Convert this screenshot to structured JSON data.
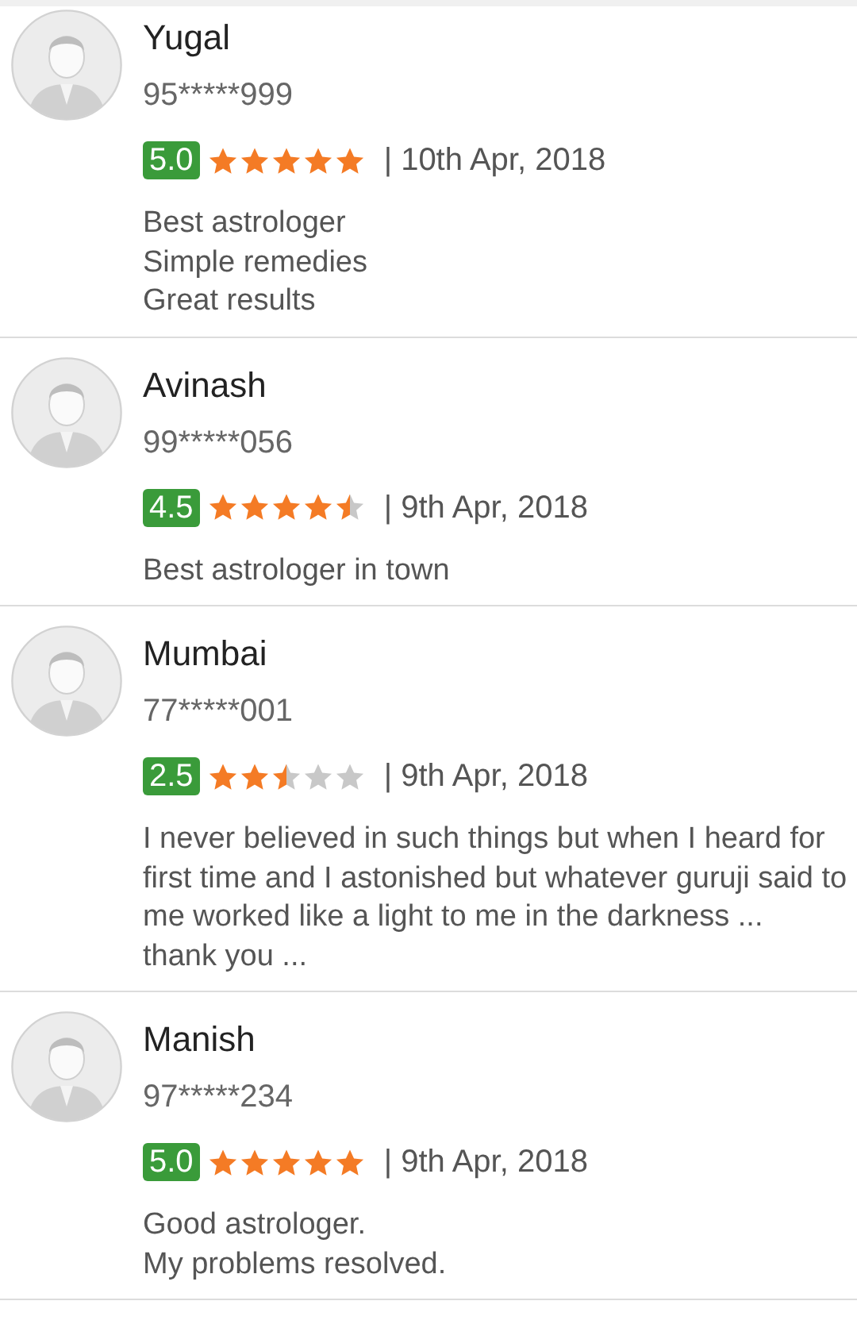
{
  "reviews": [
    {
      "name": "Yugal",
      "phone": "95*****999",
      "rating": "5.0",
      "stars": 5,
      "date": "| 10th Apr, 2018",
      "comment": "Best astrologer\nSimple remedies\nGreat results"
    },
    {
      "name": "Avinash",
      "phone": "99*****056",
      "rating": "4.5",
      "stars": 4.5,
      "date": "| 9th Apr, 2018",
      "comment": "Best astrologer in town"
    },
    {
      "name": "Mumbai",
      "phone": "77*****001",
      "rating": "2.5",
      "stars": 2.5,
      "date": "| 9th Apr, 2018",
      "comment": "I never believed in such things but when I heard for first time and I astonished but whatever guruji said to me worked like a light to me in the darkness ...\nthank you ..."
    },
    {
      "name": "Manish",
      "phone": "97*****234",
      "rating": "5.0",
      "stars": 5,
      "date": "| 9th Apr, 2018",
      "comment": "Good astrologer.\nMy problems resolved."
    }
  ]
}
